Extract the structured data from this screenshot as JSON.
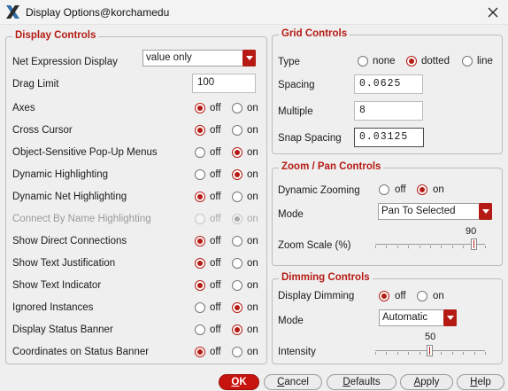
{
  "window": {
    "title": "Display Options@korchamedu"
  },
  "display_controls": {
    "legend": "Display Controls",
    "net_expression_label": "Net Expression Display",
    "net_expression_value": "value only",
    "drag_limit_label": "Drag Limit",
    "drag_limit_value": "100",
    "off_label": "off",
    "on_label": "on",
    "rows": [
      {
        "label": "Axes",
        "value": "off",
        "enabled": true
      },
      {
        "label": "Cross Cursor",
        "value": "off",
        "enabled": true
      },
      {
        "label": "Object-Sensitive Pop-Up Menus",
        "value": "on",
        "enabled": true
      },
      {
        "label": "Dynamic Highlighting",
        "value": "on",
        "enabled": true
      },
      {
        "label": "Dynamic Net Highlighting",
        "value": "off",
        "enabled": true
      },
      {
        "label": "Connect By Name Highlighting",
        "value": "on",
        "enabled": false
      },
      {
        "label": "Show Direct Connections",
        "value": "off",
        "enabled": true
      },
      {
        "label": "Show Text Justification",
        "value": "off",
        "enabled": true
      },
      {
        "label": "Show Text Indicator",
        "value": "off",
        "enabled": true
      },
      {
        "label": "Ignored Instances",
        "value": "on",
        "enabled": true
      },
      {
        "label": "Display Status Banner",
        "value": "on",
        "enabled": true
      },
      {
        "label": "Coordinates on Status Banner",
        "value": "off",
        "enabled": true
      }
    ]
  },
  "grid_controls": {
    "legend": "Grid Controls",
    "type_label": "Type",
    "type_options": [
      "none",
      "dotted",
      "line"
    ],
    "type_value": "dotted",
    "spacing_label": "Spacing",
    "spacing_value": "0.0625",
    "multiple_label": "Multiple",
    "multiple_value": "8",
    "snap_label": "Snap Spacing",
    "snap_value": "0.03125"
  },
  "zoom_pan": {
    "legend": "Zoom / Pan Controls",
    "dynamic_zooming_label": "Dynamic Zooming",
    "dynamic_zooming_value": "on",
    "mode_label": "Mode",
    "mode_value": "Pan To Selected",
    "zoom_scale_label": "Zoom Scale (%)",
    "zoom_scale_value": "90",
    "zoom_scale_fraction": 0.9
  },
  "dimming": {
    "legend": "Dimming Controls",
    "display_dimming_label": "Display Dimming",
    "display_dimming_value": "off",
    "mode_label": "Mode",
    "mode_value": "Automatic",
    "intensity_label": "Intensity",
    "intensity_value": "50",
    "intensity_fraction": 0.5
  },
  "buttons": {
    "ok_u": "O",
    "ok_rest": "K",
    "cancel_u": "C",
    "cancel_rest": "ancel",
    "defaults_u": "D",
    "defaults_rest": "efaults",
    "apply_u": "A",
    "apply_rest": "pply",
    "help_u": "H",
    "help_rest": "elp"
  },
  "colors": {
    "accent": "#b51b14"
  },
  "icons": {
    "app": "x-logo-icon",
    "close": "close-icon"
  }
}
